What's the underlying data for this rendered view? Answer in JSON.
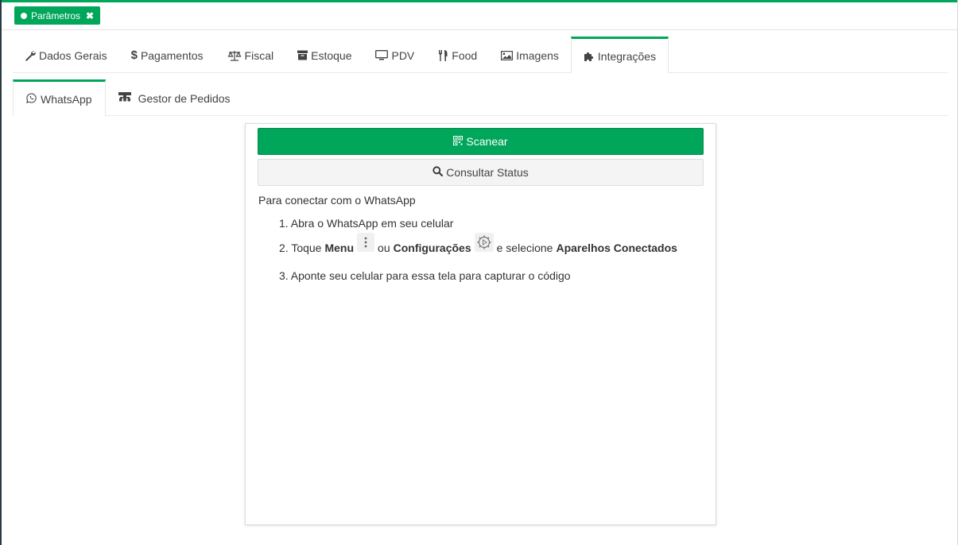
{
  "page_tab": {
    "label": "Parâmetros",
    "close": "✖"
  },
  "main_tabs": [
    {
      "label": "Dados Gerais",
      "icon": "wrench-icon"
    },
    {
      "label": "Pagamentos",
      "icon": "dollar-icon"
    },
    {
      "label": "Fiscal",
      "icon": "balance-scale-icon"
    },
    {
      "label": "Estoque",
      "icon": "archive-icon"
    },
    {
      "label": "PDV",
      "icon": "desktop-icon"
    },
    {
      "label": "Food",
      "icon": "cutlery-icon"
    },
    {
      "label": "Imagens",
      "icon": "image-icon"
    },
    {
      "label": "Integrações",
      "icon": "puzzle-icon",
      "active": true
    }
  ],
  "sub_tabs": [
    {
      "label": "WhatsApp",
      "icon": "whatsapp-icon",
      "active": true
    },
    {
      "label": "Gestor de Pedidos",
      "icon": "sitemap-icon"
    }
  ],
  "panel": {
    "scan_label": "Scanear",
    "status_label": "Consultar Status",
    "intro": "Para conectar com o WhatsApp",
    "step1": "1. Abra o WhatsApp em seu celular",
    "step2": {
      "prefix": "2. Toque",
      "menu": "Menu",
      "or": "ou",
      "settings": "Configurações",
      "select": "e selecione",
      "devices": "Aparelhos Conectados"
    },
    "step3": "3. Aponte seu celular para essa tela para capturar o código"
  },
  "colors": {
    "accent": "#00a65a",
    "text": "#333333",
    "status_bg": "#f4f4f4"
  }
}
